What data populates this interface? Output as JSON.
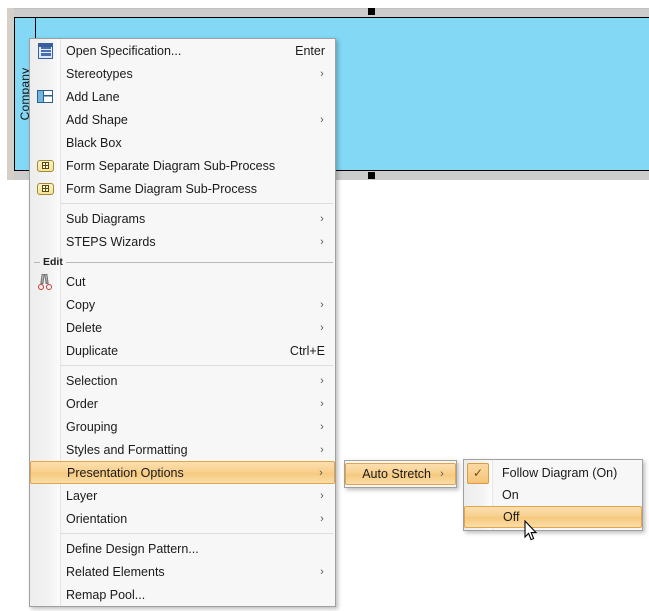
{
  "canvas": {
    "pool_label": "Company",
    "pool_fill": "#82d8f5",
    "selected": true
  },
  "main_menu": {
    "groups": [
      {
        "label": null,
        "items": [
          {
            "label": "Open Specification...",
            "icon": "specification-icon",
            "accel": "Enter",
            "submenu": false
          },
          {
            "label": "Stereotypes",
            "icon": null,
            "accel": "",
            "submenu": true
          },
          {
            "label": "Add Lane",
            "icon": "lane-icon",
            "accel": "",
            "submenu": false
          },
          {
            "label": "Add Shape",
            "icon": null,
            "accel": "",
            "submenu": true
          },
          {
            "label": "Black Box",
            "icon": null,
            "accel": "",
            "submenu": false
          },
          {
            "label": "Form Separate Diagram Sub-Process",
            "icon": "sub-process-icon",
            "accel": "",
            "submenu": false
          },
          {
            "label": "Form Same Diagram Sub-Process",
            "icon": "sub-process-icon",
            "accel": "",
            "submenu": false
          }
        ]
      },
      {
        "label": null,
        "items": [
          {
            "label": "Sub Diagrams",
            "icon": null,
            "accel": "",
            "submenu": true
          },
          {
            "label": "STEPS Wizards",
            "icon": null,
            "accel": "",
            "submenu": true
          }
        ]
      },
      {
        "label": "Edit",
        "items": [
          {
            "label": "Cut",
            "icon": "cut-icon",
            "accel": "",
            "submenu": false
          },
          {
            "label": "Copy",
            "icon": null,
            "accel": "",
            "submenu": true
          },
          {
            "label": "Delete",
            "icon": null,
            "accel": "",
            "submenu": true
          },
          {
            "label": "Duplicate",
            "icon": null,
            "accel": "Ctrl+E",
            "submenu": false
          }
        ]
      },
      {
        "label": null,
        "items": [
          {
            "label": "Selection",
            "icon": null,
            "accel": "",
            "submenu": true
          },
          {
            "label": "Order",
            "icon": null,
            "accel": "",
            "submenu": true
          },
          {
            "label": "Grouping",
            "icon": null,
            "accel": "",
            "submenu": true
          },
          {
            "label": "Styles and Formatting",
            "icon": null,
            "accel": "",
            "submenu": true
          },
          {
            "label": "Presentation Options",
            "icon": null,
            "accel": "",
            "submenu": true,
            "highlighted": true
          },
          {
            "label": "Layer",
            "icon": null,
            "accel": "",
            "submenu": true
          },
          {
            "label": "Orientation",
            "icon": null,
            "accel": "",
            "submenu": true
          }
        ]
      },
      {
        "label": null,
        "items": [
          {
            "label": "Define Design Pattern...",
            "icon": null,
            "accel": "",
            "submenu": false
          },
          {
            "label": "Related Elements",
            "icon": null,
            "accel": "",
            "submenu": true
          },
          {
            "label": "Remap Pool...",
            "icon": null,
            "accel": "",
            "submenu": false
          }
        ]
      }
    ]
  },
  "submenu_presentation": {
    "items": [
      {
        "label": "Auto Stretch",
        "submenu": true,
        "highlighted": true
      }
    ]
  },
  "submenu_autostretch": {
    "items": [
      {
        "label": "Follow Diagram (On)",
        "checked": true,
        "highlighted": false
      },
      {
        "label": "On",
        "checked": false,
        "highlighted": false
      },
      {
        "label": "Off",
        "checked": false,
        "highlighted": true
      }
    ]
  },
  "glyphs": {
    "submenu_arrow": "›",
    "check_mark": "✓"
  },
  "colors": {
    "highlight_border": "#e2a54a",
    "highlight_fill": "#f8cf8c",
    "menu_bg": "#f7f7f7",
    "pool_blue": "#82d8f5"
  }
}
